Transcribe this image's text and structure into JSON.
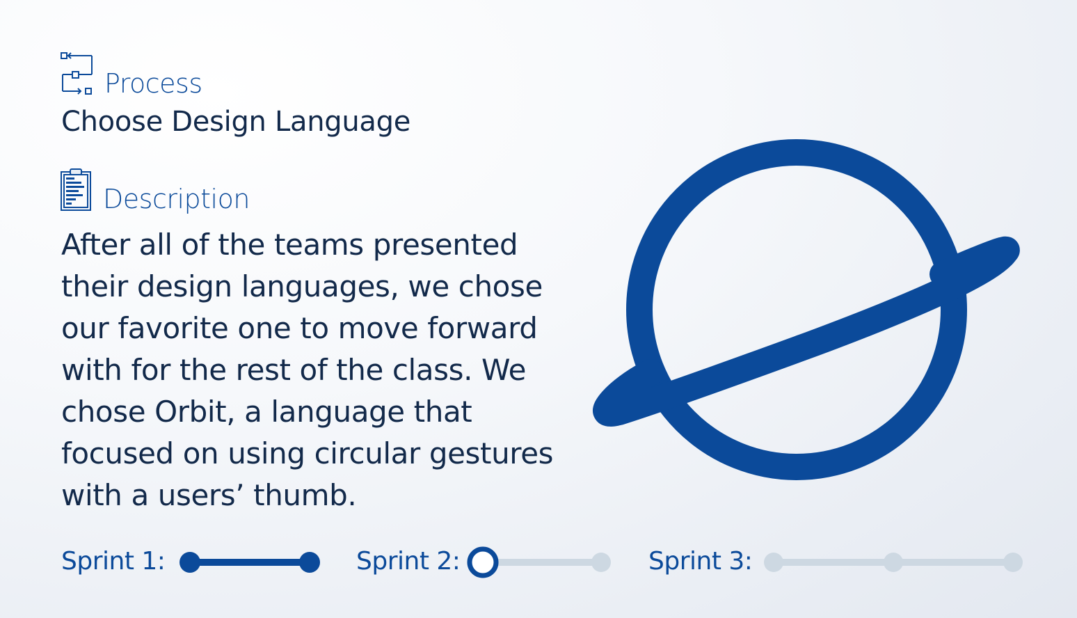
{
  "process": {
    "label": "Process",
    "icon": "flowchart-icon"
  },
  "title": "Choose Design Language",
  "description": {
    "label": "Description",
    "icon": "clipboard-icon",
    "body": "After all of the teams presented their design languages, we chose our favorite one to move forward with for the rest of the class. We chose Orbit, a language that focused on using circular gestures with a users’ thumb."
  },
  "illustration": {
    "icon": "planet-icon"
  },
  "sprints": [
    {
      "label": "Sprint 1:",
      "status": "completed"
    },
    {
      "label": "Sprint 2:",
      "status": "current"
    },
    {
      "label": "Sprint 3:",
      "status": "upcoming"
    }
  ],
  "colors": {
    "accent": "#0b4a9a",
    "text": "#12294a",
    "inactive": "#cdd8e2"
  }
}
